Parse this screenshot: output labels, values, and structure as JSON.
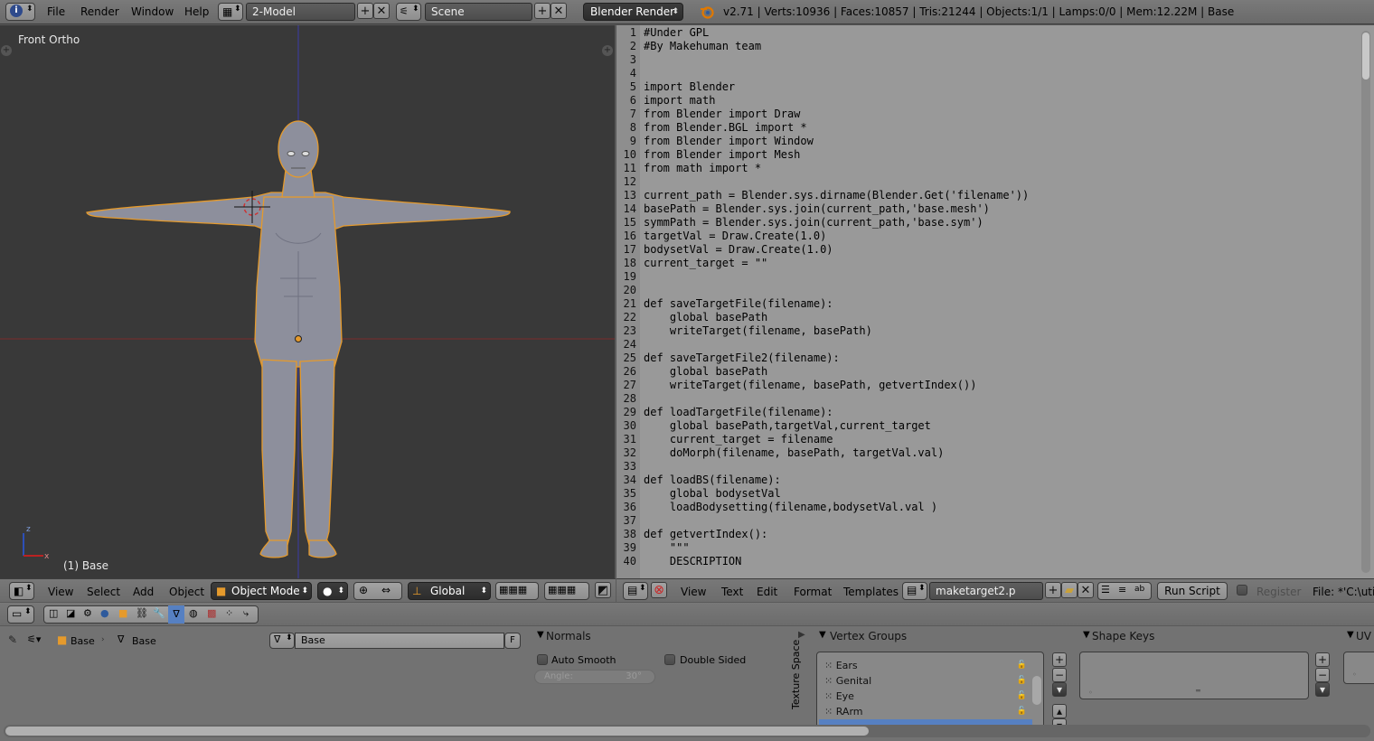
{
  "topbar": {
    "menus": [
      "File",
      "Render",
      "Window",
      "Help"
    ],
    "screen_layout": "2-Model",
    "scene": "Scene",
    "render_engine": "Blender Render",
    "stats": "v2.71 | Verts:10936 | Faces:10857 | Tris:21244 | Objects:1/1 | Lamps:0/0 | Mem:12.22M | Base"
  },
  "viewport": {
    "view_label": "Front Ortho",
    "object_label": "(1) Base"
  },
  "viewport_header": {
    "menus": [
      "View",
      "Select",
      "Add",
      "Object"
    ],
    "mode": "Object Mode",
    "orientation": "Global"
  },
  "text_editor": {
    "lines": [
      {
        "n": "1",
        "t": "#Under GPL"
      },
      {
        "n": "2",
        "t": "#By Makehuman team"
      },
      {
        "n": "3",
        "t": ""
      },
      {
        "n": "4",
        "t": ""
      },
      {
        "n": "5",
        "t": "import Blender"
      },
      {
        "n": "6",
        "t": "import math"
      },
      {
        "n": "7",
        "t": "from Blender import Draw"
      },
      {
        "n": "8",
        "t": "from Blender.BGL import *"
      },
      {
        "n": "9",
        "t": "from Blender import Window"
      },
      {
        "n": "10",
        "t": "from Blender import Mesh"
      },
      {
        "n": "11",
        "t": "from math import *"
      },
      {
        "n": "12",
        "t": ""
      },
      {
        "n": "13",
        "t": "current_path = Blender.sys.dirname(Blender.Get('filename'))"
      },
      {
        "n": "14",
        "t": "basePath = Blender.sys.join(current_path,'base.mesh')"
      },
      {
        "n": "15",
        "t": "symmPath = Blender.sys.join(current_path,'base.sym')"
      },
      {
        "n": "16",
        "t": "targetVal = Draw.Create(1.0)"
      },
      {
        "n": "17",
        "t": "bodysetVal = Draw.Create(1.0)"
      },
      {
        "n": "18",
        "t": "current_target = \"\""
      },
      {
        "n": "19",
        "t": ""
      },
      {
        "n": "20",
        "t": ""
      },
      {
        "n": "21",
        "t": "def saveTargetFile(filename):"
      },
      {
        "n": "22",
        "t": "    global basePath"
      },
      {
        "n": "23",
        "t": "    writeTarget(filename, basePath)"
      },
      {
        "n": "24",
        "t": ""
      },
      {
        "n": "25",
        "t": "def saveTargetFile2(filename):"
      },
      {
        "n": "26",
        "t": "    global basePath"
      },
      {
        "n": "27",
        "t": "    writeTarget(filename, basePath, getvertIndex())"
      },
      {
        "n": "28",
        "t": ""
      },
      {
        "n": "29",
        "t": "def loadTargetFile(filename):"
      },
      {
        "n": "30",
        "t": "    global basePath,targetVal,current_target"
      },
      {
        "n": "31",
        "t": "    current_target = filename"
      },
      {
        "n": "32",
        "t": "    doMorph(filename, basePath, targetVal.val)"
      },
      {
        "n": "33",
        "t": ""
      },
      {
        "n": "34",
        "t": "def loadBS(filename):"
      },
      {
        "n": "35",
        "t": "    global bodysetVal"
      },
      {
        "n": "36",
        "t": "    loadBodysetting(filename,bodysetVal.val )"
      },
      {
        "n": "37",
        "t": ""
      },
      {
        "n": "38",
        "t": "def getvertIndex():"
      },
      {
        "n": "39",
        "t": "    \"\"\""
      },
      {
        "n": "40",
        "t": "    DESCRIPTION"
      }
    ]
  },
  "text_header": {
    "menus": [
      "View",
      "Text",
      "Edit",
      "Format",
      "Templates"
    ],
    "filename": "maketarget2.p",
    "run_script": "Run Script",
    "register": "Register",
    "file_path": "File: *'C:\\utilit"
  },
  "properties": {
    "breadcrumb_object": "Base",
    "breadcrumb_mesh": "Base",
    "mesh_name": "Base",
    "fake_user": "F",
    "normals": {
      "title": "Normals",
      "auto_smooth": "Auto Smooth",
      "double_sided": "Double Sided",
      "angle_label": "Angle:",
      "angle_value": "30°"
    },
    "texture_space_tab": "Texture Space",
    "vertex_groups": {
      "title": "Vertex Groups",
      "items": [
        "Ears",
        "Genital",
        "Eye",
        "RArm"
      ]
    },
    "shape_keys_title": "Shape Keys",
    "uv_title": "UV"
  }
}
